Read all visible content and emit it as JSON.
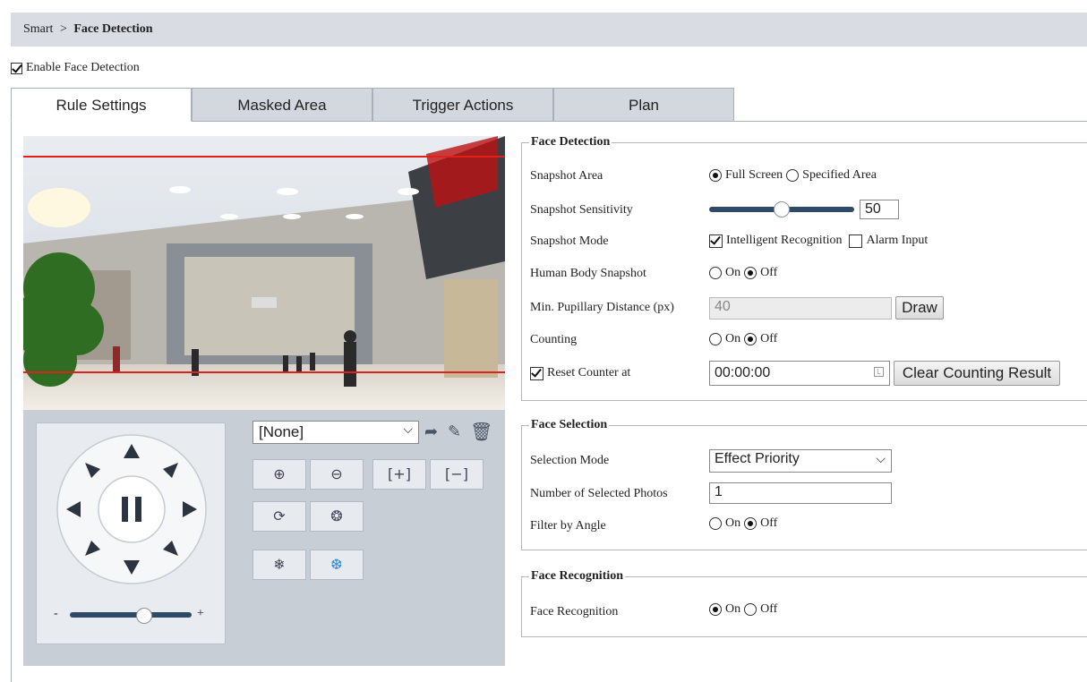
{
  "breadcrumb": {
    "root": "Smart",
    "separator": ">",
    "current": "Face Detection"
  },
  "enable": {
    "label": "Enable Face Detection",
    "checked": true
  },
  "tabs": [
    {
      "label": "Rule Settings",
      "active": true
    },
    {
      "label": "Masked Area",
      "active": false
    },
    {
      "label": "Trigger Actions",
      "active": false
    },
    {
      "label": "Plan",
      "active": false
    }
  ],
  "ptz": {
    "preset_value": "[None]",
    "zoom_min": "-",
    "zoom_max": "+"
  },
  "face_detection": {
    "title": "Face Detection",
    "snapshot_area": {
      "label": "Snapshot Area",
      "options": [
        "Full Screen",
        "Specified Area"
      ],
      "selected": "Full Screen"
    },
    "snapshot_sensitivity": {
      "label": "Snapshot Sensitivity",
      "value": "50"
    },
    "snapshot_mode": {
      "label": "Snapshot Mode",
      "option1": "Intelligent Recognition",
      "option1_checked": true,
      "option2": "Alarm Input",
      "option2_checked": false
    },
    "human_body_snapshot": {
      "label": "Human Body Snapshot",
      "on": "On",
      "off": "Off",
      "selected": "Off"
    },
    "min_pupillary": {
      "label": "Min. Pupillary Distance (px)",
      "value": "40",
      "button": "Draw"
    },
    "counting": {
      "label": "Counting",
      "on": "On",
      "off": "Off",
      "selected": "Off"
    },
    "reset_counter": {
      "label": "Reset Counter at",
      "checked": true,
      "value": "00:00:00",
      "button": "Clear Counting Result"
    }
  },
  "face_selection": {
    "title": "Face Selection",
    "selection_mode": {
      "label": "Selection Mode",
      "value": "Effect Priority"
    },
    "number_selected": {
      "label": "Number of Selected Photos",
      "value": "1"
    },
    "filter_angle": {
      "label": "Filter by Angle",
      "on": "On",
      "off": "Off",
      "selected": "Off"
    }
  },
  "face_recognition": {
    "title": "Face Recognition",
    "toggle": {
      "label": "Face Recognition",
      "on": "On",
      "off": "Off",
      "selected": "On"
    }
  }
}
